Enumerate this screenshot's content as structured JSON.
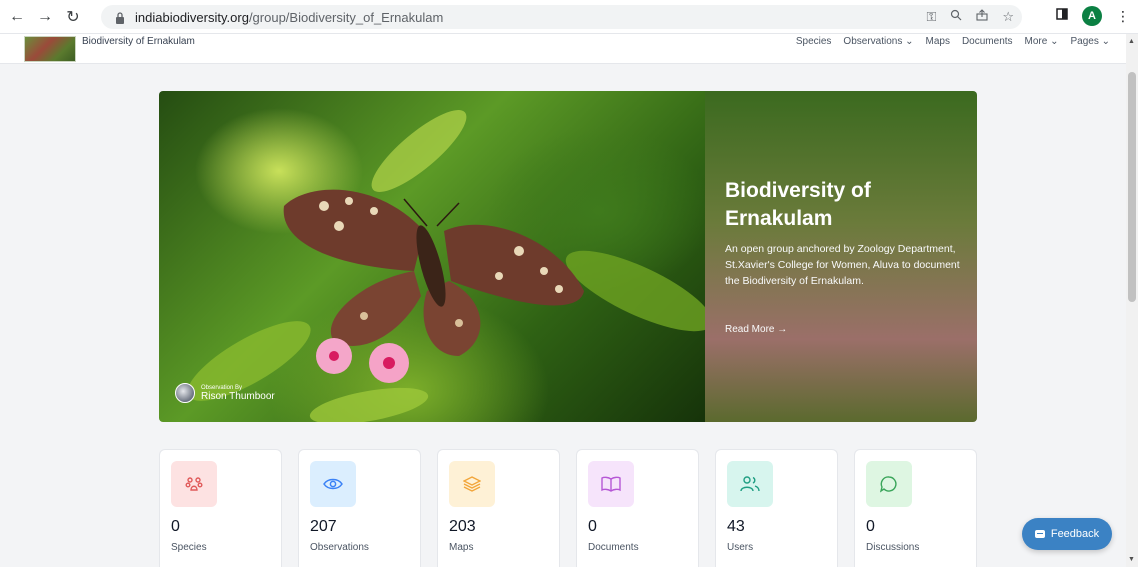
{
  "browser": {
    "url_host": "indiabiodiversity.org",
    "url_path": "/group/Biodiversity_of_Ernakulam",
    "profile_initial": "A"
  },
  "site": {
    "name": "Biodiversity of Ernakulam",
    "nav": {
      "species": "Species",
      "observations": "Observations ⌄",
      "maps": "Maps",
      "documents": "Documents",
      "more": "More ⌄",
      "pages": "Pages ⌄"
    }
  },
  "hero": {
    "title": "Biodiversity of Ernakulam",
    "description": "An open group anchored by Zoology Department, St.Xavier's College for Women, Aluva to document the Biodiversity of Ernakulam.",
    "read_more": "Read More →",
    "observation_label": "Observation By",
    "observer_name": "Rison Thumboor"
  },
  "stats": [
    {
      "value": "0",
      "label": "Species",
      "icon": "paw-icon",
      "bg": "#fde2e2",
      "color": "#e05a5a"
    },
    {
      "value": "207",
      "label": "Observations",
      "icon": "eye-icon",
      "bg": "#dbeefe",
      "color": "#3b82f6"
    },
    {
      "value": "203",
      "label": "Maps",
      "icon": "layers-icon",
      "bg": "#fef1d6",
      "color": "#f2a53a"
    },
    {
      "value": "0",
      "label": "Documents",
      "icon": "book-icon",
      "bg": "#f6e4fb",
      "color": "#b657d6"
    },
    {
      "value": "43",
      "label": "Users",
      "icon": "users-icon",
      "bg": "#d7f5ee",
      "color": "#1f9e82"
    },
    {
      "value": "0",
      "label": "Discussions",
      "icon": "chat-icon",
      "bg": "#def6e2",
      "color": "#3aa55a"
    }
  ],
  "feedback": {
    "label": "Feedback"
  },
  "colors": {
    "accent": "#3b82c4"
  }
}
